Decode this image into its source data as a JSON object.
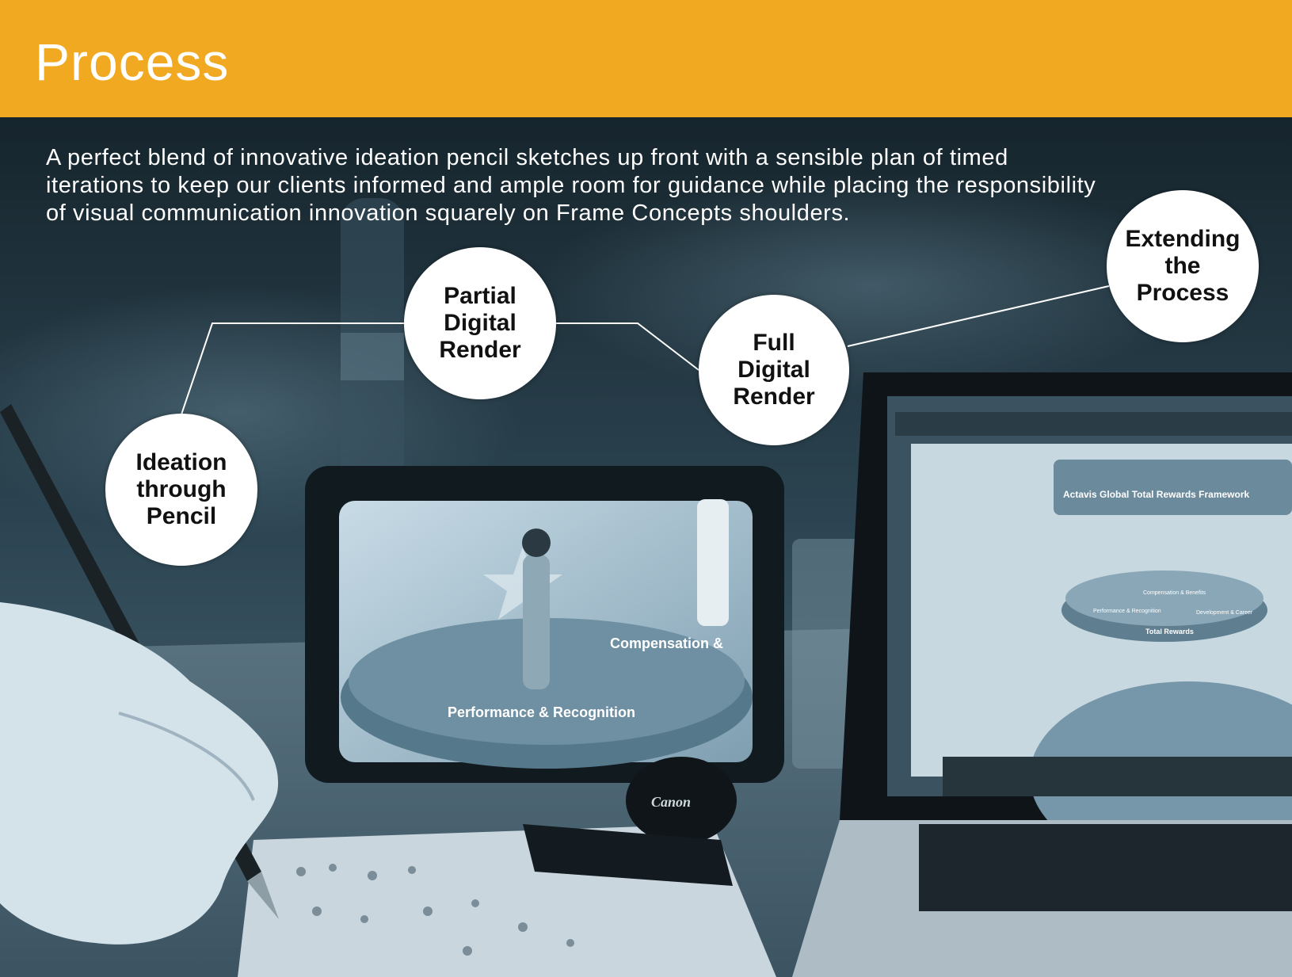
{
  "header": {
    "title": "Process",
    "color": "#f2a922"
  },
  "intro": "A perfect blend of innovative ideation pencil sketches up front with a sensible plan of timed iterations to keep our clients informed and ample room for guidance while placing the responsibility of visual communication innovation squarely on Frame Concepts shoulders.",
  "steps": [
    {
      "label": "Ideation\nthrough\nPencil"
    },
    {
      "label": "Partial\nDigital\nRender"
    },
    {
      "label": "Full\nDigital\nRender"
    },
    {
      "label": "Extending\nthe\nProcess"
    }
  ],
  "photo": {
    "tablet_labels": [
      "Compensation &",
      "Performance & Recognition"
    ],
    "laptop_title": "Actavis Global Total Rewards Framework",
    "laptop_labels": [
      "Compensation & Benefits",
      "Performance & Recognition",
      "Development & Career",
      "Total Rewards"
    ],
    "lens_cap_brand": "Canon"
  }
}
